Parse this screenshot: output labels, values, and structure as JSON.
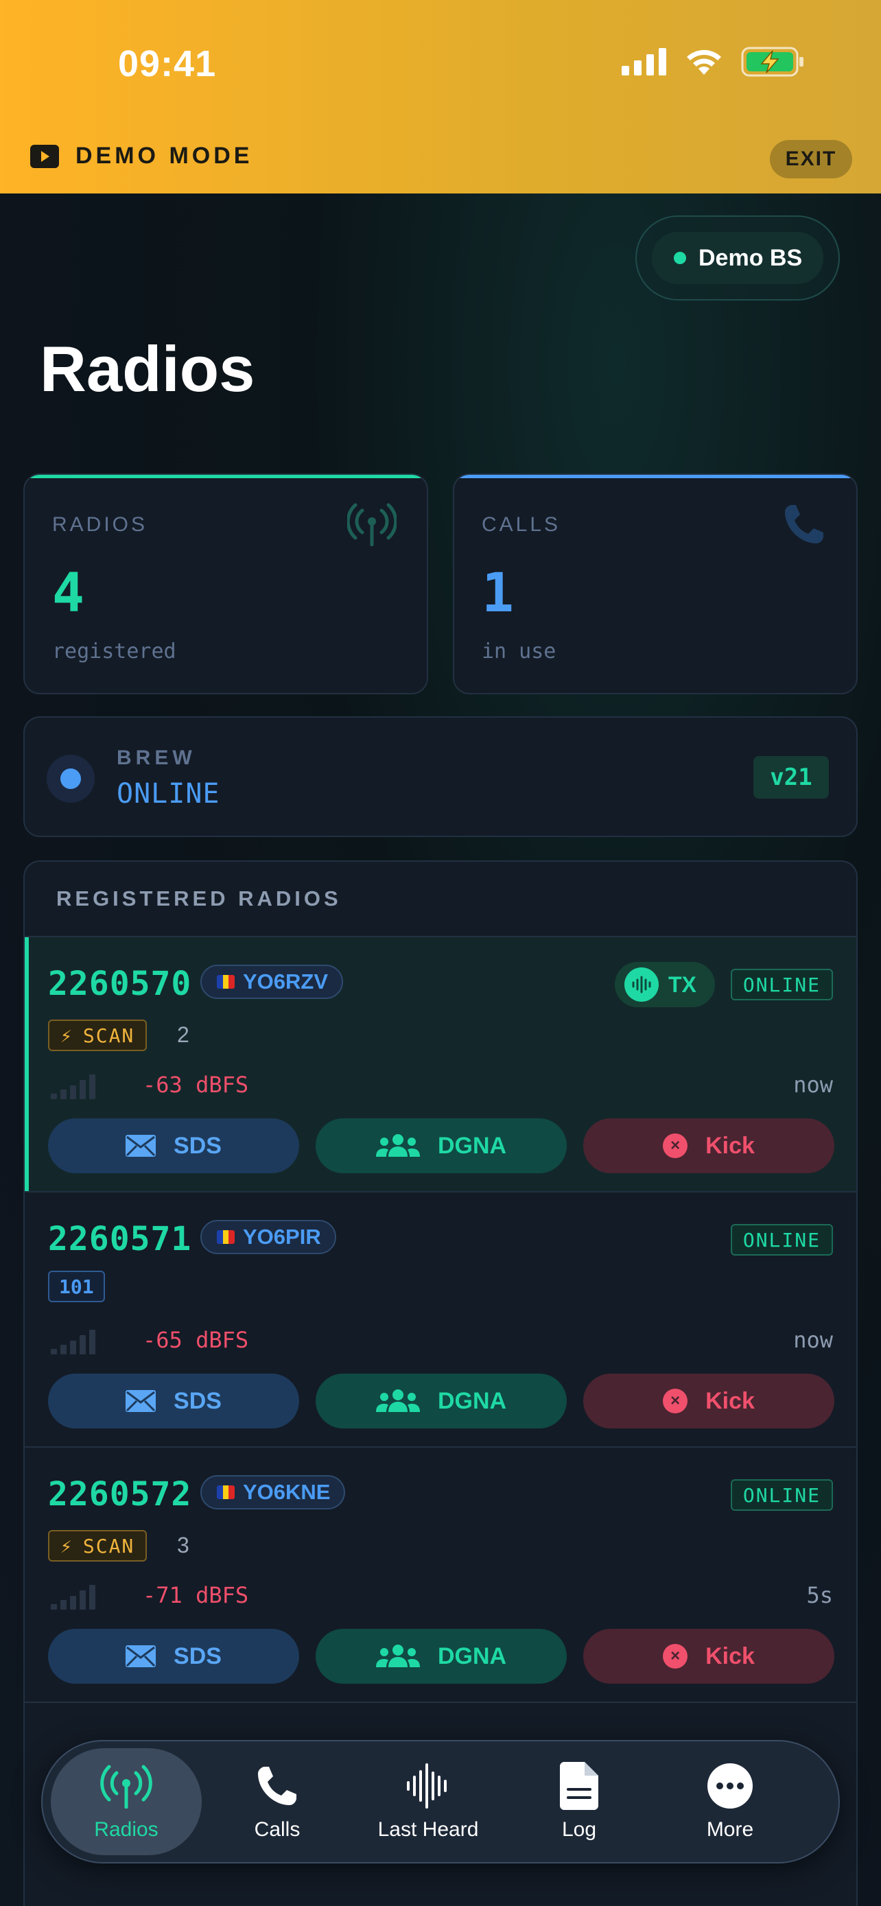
{
  "status_bar": {
    "time": "09:41"
  },
  "demo_banner": {
    "label": "DEMO MODE",
    "exit_label": "EXIT"
  },
  "base_station": {
    "label": "Demo BS"
  },
  "page": {
    "title": "Radios"
  },
  "stats": {
    "radios": {
      "label": "RADIOS",
      "value": "4",
      "sub": "registered",
      "color": "#1fd9a4"
    },
    "calls": {
      "label": "CALLS",
      "value": "1",
      "sub": "in use",
      "color": "#4b9cf5"
    }
  },
  "brew": {
    "label": "BREW",
    "status": "ONLINE",
    "version": "v21"
  },
  "registered": {
    "title": "REGISTERED RADIOS",
    "radios": [
      {
        "id": "2260570",
        "callsign": "YO6RZV",
        "tx": "TX",
        "status": "ONLINE",
        "scan": "SCAN",
        "scan_count": "2",
        "group": "",
        "signal_bars": 0,
        "dbfs": "-63 dBFS",
        "seen": "now"
      },
      {
        "id": "2260571",
        "callsign": "YO6PIR",
        "tx": "",
        "status": "ONLINE",
        "scan": "",
        "scan_count": "",
        "group": "101",
        "signal_bars": 0,
        "dbfs": "-65 dBFS",
        "seen": "now"
      },
      {
        "id": "2260572",
        "callsign": "YO6KNE",
        "tx": "",
        "status": "ONLINE",
        "scan": "SCAN",
        "scan_count": "3",
        "group": "",
        "signal_bars": 0,
        "dbfs": "-71 dBFS",
        "seen": "5s"
      }
    ],
    "actions": {
      "sds": "SDS",
      "dgna": "DGNA",
      "kick": "Kick"
    }
  },
  "tabbar": {
    "items": [
      {
        "label": "Radios",
        "icon": "antenna-icon",
        "active": true
      },
      {
        "label": "Calls",
        "icon": "phone-icon",
        "active": false
      },
      {
        "label": "Last Heard",
        "icon": "waveform-icon",
        "active": false
      },
      {
        "label": "Log",
        "icon": "document-icon",
        "active": false
      },
      {
        "label": "More",
        "icon": "ellipsis-icon",
        "active": false
      }
    ]
  },
  "colors": {
    "accent_green": "#1fd9a4",
    "accent_blue": "#4b9cf5",
    "danger": "#f0506c",
    "warning": "#f0b43c",
    "banner": "#ffb326"
  }
}
